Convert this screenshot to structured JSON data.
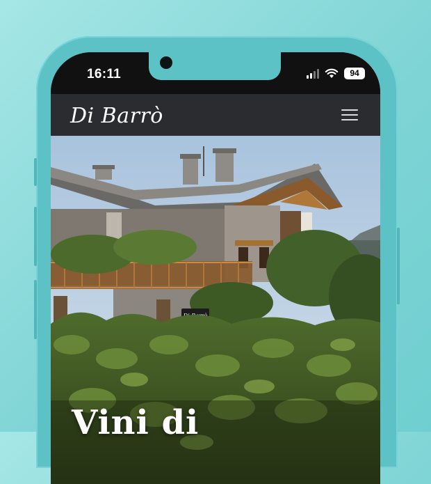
{
  "device": {
    "status_bar": {
      "time": "16:11",
      "battery": "94",
      "signal_icon": "cellular-signal-icon",
      "wifi_icon": "wifi-icon"
    }
  },
  "header": {
    "logo_text": "Di Barrò",
    "menu_icon": "hamburger-menu-icon"
  },
  "hero": {
    "title": "Vini di",
    "sign_text": "Di Barrò",
    "sign_subtext": "Vini di Montagna"
  },
  "colors": {
    "background": "#7fd4d5",
    "phone_frame": "#5cc2c6",
    "navbar": "#2b2c2f",
    "status_bar": "#111111"
  }
}
